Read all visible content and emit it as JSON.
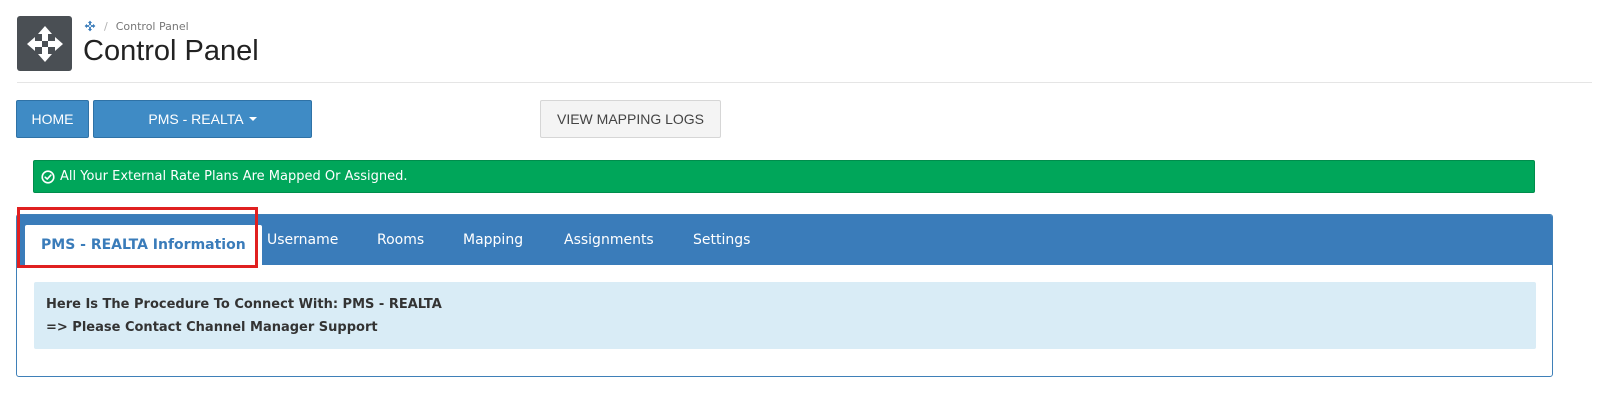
{
  "header": {
    "icon": "move-arrows-icon",
    "breadcrumb": {
      "home_icon": "move-arrows-icon",
      "separator": "/",
      "current": "Control Panel"
    },
    "title": "Control Panel"
  },
  "toolbar": {
    "home_label": "HOME",
    "pms_dropdown_label": "PMS - REALTA",
    "view_logs_label": "VIEW MAPPING LOGS"
  },
  "alert": {
    "icon": "check-circle-icon",
    "message": "All Your External Rate Plans Are Mapped Or Assigned."
  },
  "tabs": {
    "items": [
      {
        "label": "PMS - REALTA Information",
        "active": true
      },
      {
        "label": "Username",
        "active": false
      },
      {
        "label": "Rooms",
        "active": false
      },
      {
        "label": "Mapping",
        "active": false
      },
      {
        "label": "Assignments",
        "active": false
      },
      {
        "label": "Settings",
        "active": false
      }
    ]
  },
  "info": {
    "line1": "Here Is The Procedure To Connect With: PMS - REALTA",
    "line2": "=> Please Contact Channel Manager Support"
  },
  "colors": {
    "primary": "#3a7cba",
    "success": "#00a65a",
    "info_bg": "#d9ecf6",
    "highlight": "#e02020",
    "header_icon_bg": "#4a4f54"
  }
}
